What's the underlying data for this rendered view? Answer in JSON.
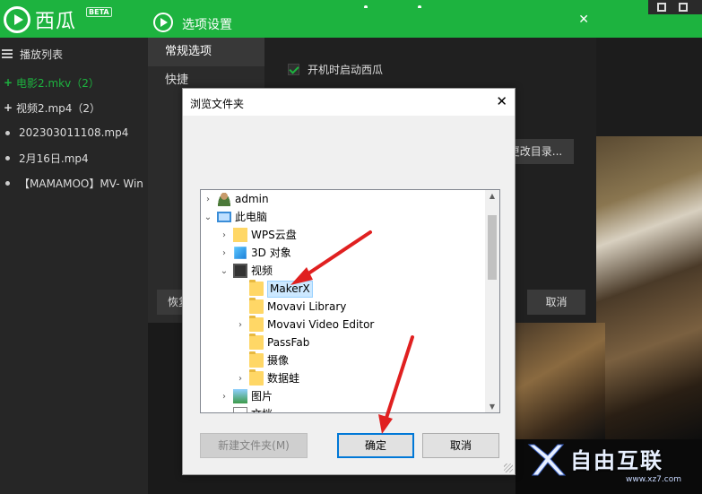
{
  "app": {
    "logo_text": "西瓜",
    "beta_label": "BETA"
  },
  "sidebar": {
    "header": "播放列表",
    "items": [
      {
        "label": "电影2.mkv（2）",
        "type": "group",
        "active": true
      },
      {
        "label": "视频2.mp4（2）",
        "type": "group",
        "active": false
      },
      {
        "label": "202303011108.mp4",
        "type": "file",
        "active": false
      },
      {
        "label": "2月16日.mp4",
        "type": "file",
        "active": false
      },
      {
        "label": "【MAMAMOO】MV- Win",
        "type": "file",
        "active": false
      }
    ]
  },
  "options_dialog": {
    "title": "选项设置",
    "nav": [
      "常规选项",
      "快捷"
    ],
    "autostart_label": "开机时启动西瓜",
    "change_dir_label": "更改目录...",
    "restore_label": "恢复",
    "cancel_label": "取消"
  },
  "browse_dialog": {
    "title": "浏览文件夹",
    "tree": [
      {
        "label": "admin",
        "icon": "user-icon",
        "expander": "collapsed",
        "level": 0
      },
      {
        "label": "此电脑",
        "icon": "computer-icon",
        "expander": "expanded",
        "level": 0
      },
      {
        "label": "WPS云盘",
        "icon": "cloud-folder-icon",
        "expander": "collapsed",
        "level": 1
      },
      {
        "label": "3D 对象",
        "icon": "3d-objects-icon",
        "expander": "collapsed",
        "level": 1
      },
      {
        "label": "视频",
        "icon": "video-folder-icon",
        "expander": "expanded",
        "level": 1
      },
      {
        "label": "MakerX",
        "icon": "folder-icon",
        "expander": "none",
        "level": 2,
        "selected": true
      },
      {
        "label": "Movavi Library",
        "icon": "folder-icon",
        "expander": "none",
        "level": 2
      },
      {
        "label": "Movavi Video Editor",
        "icon": "folder-icon",
        "expander": "collapsed",
        "level": 2
      },
      {
        "label": "PassFab",
        "icon": "folder-icon",
        "expander": "none",
        "level": 2
      },
      {
        "label": "摄像",
        "icon": "folder-icon",
        "expander": "none",
        "level": 2
      },
      {
        "label": "数据蛙",
        "icon": "folder-icon",
        "expander": "collapsed",
        "level": 2
      },
      {
        "label": "图片",
        "icon": "pictures-icon",
        "expander": "collapsed",
        "level": 1
      },
      {
        "label": "文档",
        "icon": "documents-icon",
        "expander": "collapsed",
        "level": 1
      }
    ],
    "new_folder_label": "新建文件夹(M)",
    "ok_label": "确定",
    "cancel_label": "取消"
  },
  "watermark": {
    "brand": "自由互联",
    "url": "www.xz7.com"
  },
  "colors": {
    "accent": "#1db33f",
    "arrow": "#e02020",
    "selection": "#cce8ff",
    "focus_border": "#0078d7"
  }
}
